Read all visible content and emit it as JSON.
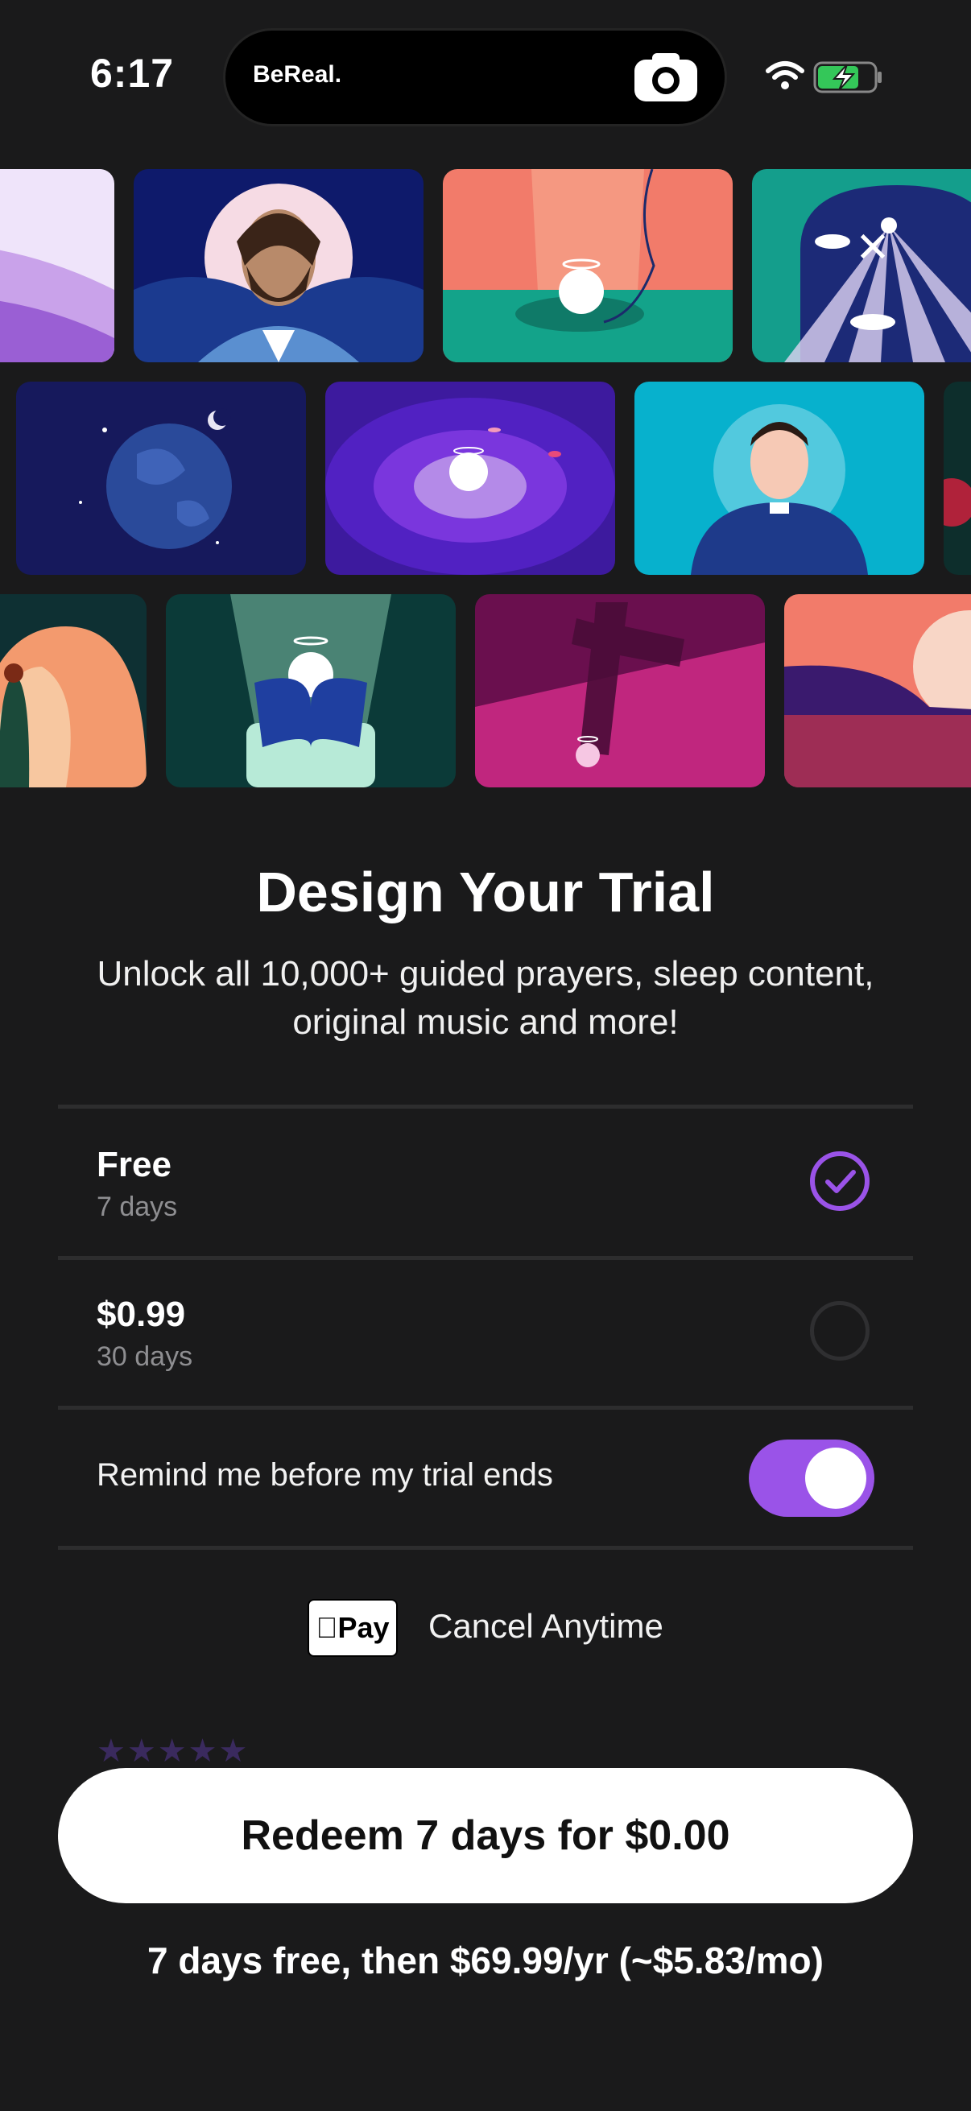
{
  "status_bar": {
    "time": "6:17",
    "island_app": "BeReal.",
    "icons": [
      "camera-icon",
      "wifi-icon",
      "battery-charging-icon"
    ]
  },
  "header": {
    "close_label": "✕"
  },
  "paywall": {
    "title": "Design Your Trial",
    "subtitle": "Unlock all 10,000+ guided prayers, sleep content, original music and more!",
    "options": [
      {
        "name": "Free",
        "duration": "7 days",
        "selected": true
      },
      {
        "name": "$0.99",
        "duration": "30 days",
        "selected": false
      }
    ],
    "reminder": {
      "label": "Remind me before my trial ends",
      "enabled": true
    },
    "payment": {
      "applepay_label": "Pay",
      "cancel_text": "Cancel Anytime"
    },
    "rating_stars": "★★★★★",
    "cta_label": "Redeem 7 days for $0.00",
    "footer_text": "7 days free, then $69.99/yr (~$5.83/mo)"
  },
  "colors": {
    "accent": "#9a53e8",
    "background": "#1a1a1b",
    "cta": "#ffffff"
  }
}
